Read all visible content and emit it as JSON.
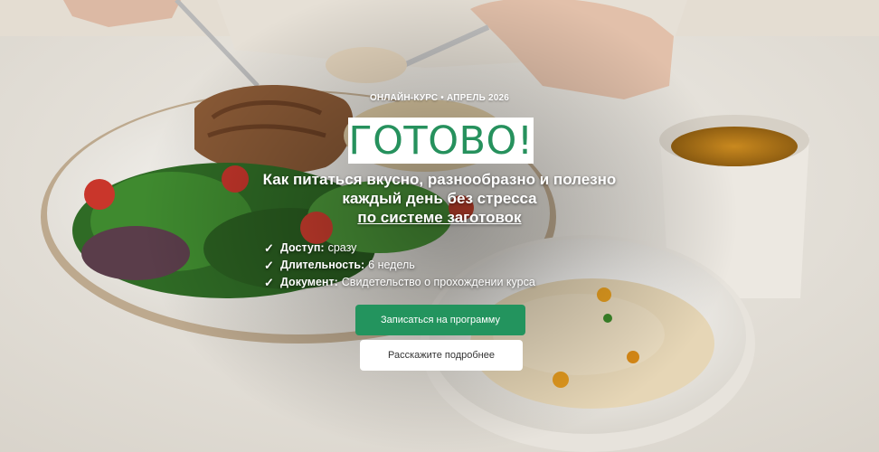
{
  "hero": {
    "eyebrow": "ОНЛАЙН-КУРС • АПРЕЛЬ 2026",
    "title": "ГОТОВО!",
    "subtitle_line1": "Как питаться вкусно, разнообразно и полезно",
    "subtitle_line2": "каждый день без стресса",
    "subtitle_link": "по системе заготовок",
    "features": [
      {
        "label": "Доступ:",
        "value": "сразу"
      },
      {
        "label": "Длительность:",
        "value": "6 недель"
      },
      {
        "label": "Документ:",
        "value": "Свидетельство о прохождении курса"
      }
    ],
    "primary_button": "Записаться на программу",
    "secondary_button": "Расскажите подробнее",
    "check_icon": "check-icon",
    "colors": {
      "accent": "#23945e",
      "title": "#26915d"
    }
  }
}
